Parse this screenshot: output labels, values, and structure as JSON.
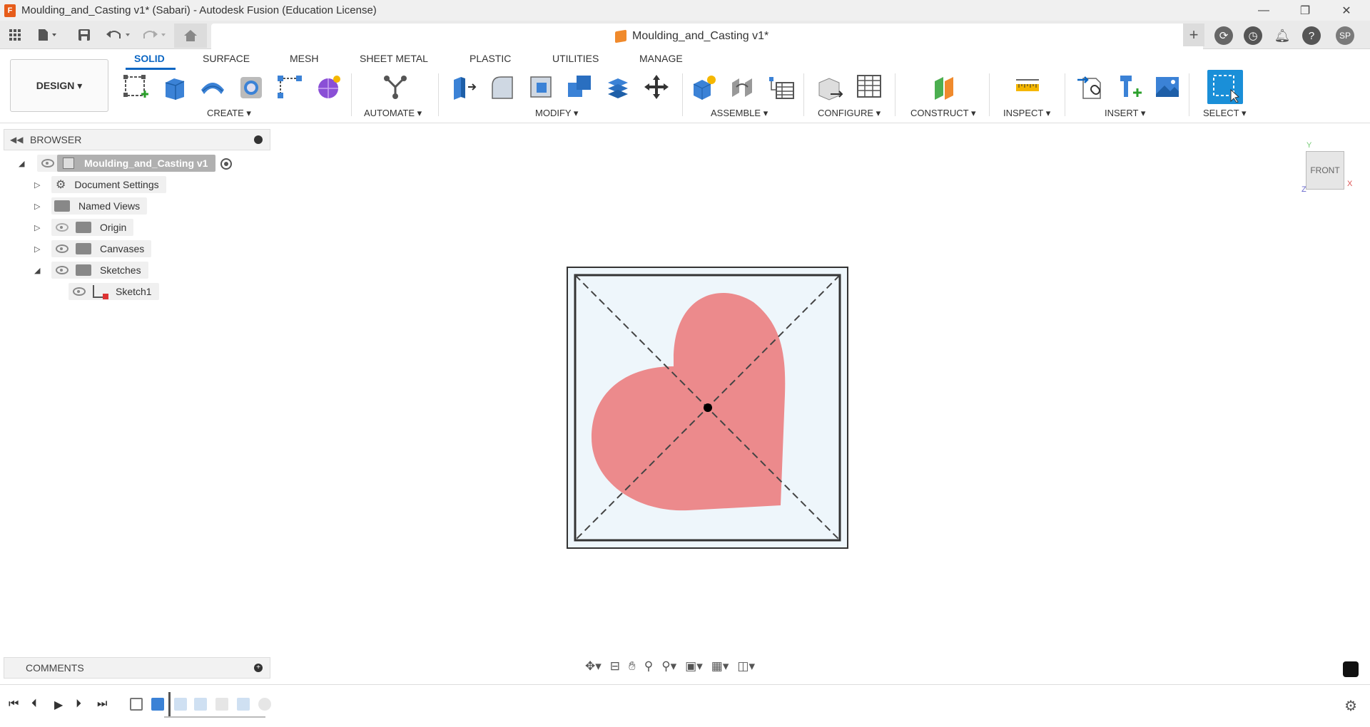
{
  "window": {
    "title": "Moulding_and_Casting v1* (Sabari) - Autodesk Fusion (Education License)",
    "app_icon_letter": "F",
    "minimize": "—",
    "restore": "❐",
    "close": "✕"
  },
  "qat": {
    "doc_tab_title": "Moulding_and_Casting v1*",
    "doc_tab_close": "✕",
    "user_initials": "SP"
  },
  "ribbon": {
    "workspace": "DESIGN ▾",
    "tabs": [
      "SOLID",
      "SURFACE",
      "MESH",
      "SHEET METAL",
      "PLASTIC",
      "UTILITIES",
      "MANAGE"
    ],
    "groups": [
      "CREATE ▾",
      "AUTOMATE ▾",
      "MODIFY ▾",
      "ASSEMBLE ▾",
      "CONFIGURE ▾",
      "CONSTRUCT ▾",
      "INSPECT ▾",
      "INSERT ▾",
      "SELECT ▾"
    ]
  },
  "browser": {
    "title": "BROWSER",
    "items": [
      {
        "label": "Moulding_and_Casting v1"
      },
      {
        "label": "Document Settings"
      },
      {
        "label": "Named Views"
      },
      {
        "label": "Origin"
      },
      {
        "label": "Canvases"
      },
      {
        "label": "Sketches"
      },
      {
        "label": "Sketch1"
      }
    ]
  },
  "comments": {
    "title": "COMMENTS"
  },
  "viewcube": {
    "face": "FRONT",
    "axis_y": "Y",
    "axis_x": "X",
    "axis_z": "Z"
  },
  "colors": {
    "accent": "#0b66c3",
    "heart_fill": "#ec8a8c",
    "canvas_bg": "#eef6fb"
  }
}
